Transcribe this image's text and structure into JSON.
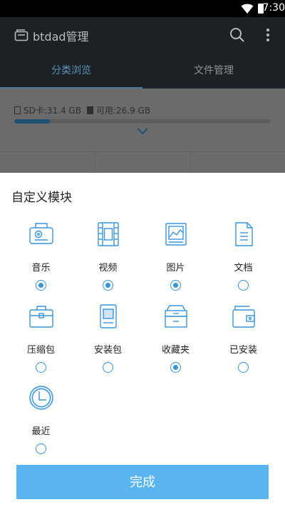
{
  "status_bar": {
    "time": "7:30"
  },
  "app_bar": {
    "title": "btdad管理"
  },
  "tabs": [
    {
      "label": "分类浏览",
      "active": true
    },
    {
      "label": "文件管理",
      "active": false
    }
  ],
  "storage": {
    "sd_label": "SD卡:31.4 GB",
    "available_label": "可用:26.9 GB",
    "used_fraction": 0.14
  },
  "sheet": {
    "title": "自定义模块",
    "modules": [
      {
        "label": "音乐",
        "icon": "music-icon",
        "checked": true
      },
      {
        "label": "视频",
        "icon": "video-icon",
        "checked": true
      },
      {
        "label": "图片",
        "icon": "picture-icon",
        "checked": true
      },
      {
        "label": "文档",
        "icon": "document-icon",
        "checked": false
      },
      {
        "label": "压缩包",
        "icon": "archive-icon",
        "checked": false
      },
      {
        "label": "安装包",
        "icon": "package-icon",
        "checked": false
      },
      {
        "label": "收藏夹",
        "icon": "favorites-icon",
        "checked": true
      },
      {
        "label": "已安装",
        "icon": "installed-icon",
        "checked": false
      },
      {
        "label": "最近",
        "icon": "clock-icon",
        "checked": false
      }
    ],
    "done_label": "完成"
  },
  "colors": {
    "accent": "#3a94d8",
    "done_button": "#5ab4f0",
    "app_bar": "#1d2125"
  }
}
